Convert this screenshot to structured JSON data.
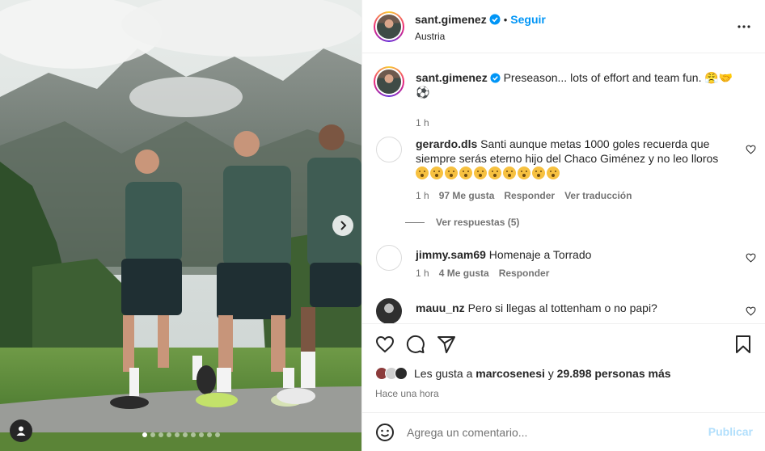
{
  "post": {
    "author": "sant.gimenez",
    "follow_label": "Seguir",
    "separator": "•",
    "location": "Austria",
    "more_icon": "more-horizontal-icon"
  },
  "caption": {
    "username": "sant.gimenez",
    "text": "Preseason... lots of effort and team fun. 😤🤝",
    "text_line2": "⚽",
    "time": "1 h"
  },
  "comments": [
    {
      "username": "gerardo.dls",
      "text": "Santi aunque metas 1000 goles recuerda que siempre serás eterno hijo del Chaco Giménez y no leo lloros",
      "emoji_count": 10,
      "time": "1 h",
      "likes": "97 Me gusta",
      "reply": "Responder",
      "translate": "Ver traducción",
      "view_replies": "Ver respuestas (5)"
    },
    {
      "username": "jimmy.sam69",
      "text": "Homenaje a Torrado",
      "time": "1 h",
      "likes": "4 Me gusta",
      "reply": "Responder"
    },
    {
      "username": "mauu_nz",
      "text": "Pero si llegas al tottenham o no papi?"
    }
  ],
  "likes_summary": {
    "prefix": "Les gusta a",
    "user": "marcosenesi",
    "connector": "y",
    "count": "29.898 personas más"
  },
  "time_ago": "Hace una hora",
  "add_comment": {
    "placeholder": "Agrega un comentario...",
    "publish_label": "Publicar"
  },
  "carousel": {
    "total": 10,
    "active_index": 0
  },
  "colors": {
    "accent": "#0095f6",
    "publish_disabled": "#b2dffc",
    "verified": "#0095f6"
  }
}
